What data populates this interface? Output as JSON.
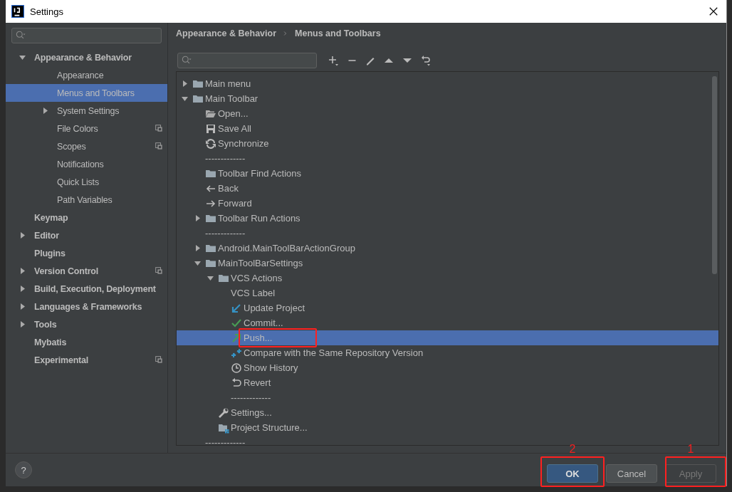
{
  "window": {
    "title": "Settings"
  },
  "sidebar": {
    "items": [
      {
        "label": "Appearance & Behavior",
        "expanded": true,
        "selected": false,
        "project_level": false,
        "children": [
          {
            "label": "Appearance",
            "selected": false,
            "project_level": false
          },
          {
            "label": "Menus and Toolbars",
            "selected": true,
            "project_level": false
          },
          {
            "label": "System Settings",
            "expanded": false,
            "selected": false,
            "project_level": false
          },
          {
            "label": "File Colors",
            "selected": false,
            "project_level": true
          },
          {
            "label": "Scopes",
            "selected": false,
            "project_level": true
          },
          {
            "label": "Notifications",
            "selected": false,
            "project_level": false
          },
          {
            "label": "Quick Lists",
            "selected": false,
            "project_level": false
          },
          {
            "label": "Path Variables",
            "selected": false,
            "project_level": false
          }
        ]
      },
      {
        "label": "Keymap",
        "selected": false,
        "project_level": false
      },
      {
        "label": "Editor",
        "expanded": false,
        "selected": false,
        "project_level": false
      },
      {
        "label": "Plugins",
        "selected": false,
        "project_level": false
      },
      {
        "label": "Version Control",
        "expanded": false,
        "selected": false,
        "project_level": true
      },
      {
        "label": "Build, Execution, Deployment",
        "expanded": false,
        "selected": false,
        "project_level": false
      },
      {
        "label": "Languages & Frameworks",
        "expanded": false,
        "selected": false,
        "project_level": false
      },
      {
        "label": "Tools",
        "expanded": false,
        "selected": false,
        "project_level": false
      },
      {
        "label": "Mybatis",
        "selected": false,
        "project_level": false
      },
      {
        "label": "Experimental",
        "selected": false,
        "project_level": true
      }
    ]
  },
  "breadcrumb": [
    "Appearance & Behavior",
    "Menus and Toolbars"
  ],
  "toolbar": [
    {
      "kind": "add"
    },
    {
      "kind": "remove"
    },
    {
      "kind": "edit"
    },
    {
      "kind": "up"
    },
    {
      "kind": "down"
    },
    {
      "kind": "restore"
    }
  ],
  "tree": [
    {
      "label": "Main menu",
      "kind": "folder",
      "expanded": false,
      "selected": false
    },
    {
      "label": "Main Toolbar",
      "kind": "folder",
      "expanded": true,
      "selected": false,
      "children": [
        {
          "label": "Open...",
          "kind": "open",
          "selected": false
        },
        {
          "label": "Save All",
          "kind": "save",
          "selected": false
        },
        {
          "label": "Synchronize",
          "kind": "sync",
          "selected": false
        },
        {
          "label": "-------------",
          "kind": "separator",
          "selected": false
        },
        {
          "label": "Toolbar Find Actions",
          "kind": "folder",
          "selected": false
        },
        {
          "label": "Back",
          "kind": "back",
          "selected": false
        },
        {
          "label": "Forward",
          "kind": "forward",
          "selected": false
        },
        {
          "label": "Toolbar Run Actions",
          "kind": "folder",
          "expanded": false,
          "selected": false
        },
        {
          "label": "-------------",
          "kind": "separator",
          "selected": false
        },
        {
          "label": "Android.MainToolBarActionGroup",
          "kind": "folder",
          "expanded": false,
          "selected": false
        },
        {
          "label": "MainToolBarSettings",
          "kind": "folder",
          "expanded": true,
          "selected": false,
          "children": [
            {
              "label": "VCS Actions",
              "kind": "folder",
              "expanded": true,
              "selected": false,
              "children": [
                {
                  "label": "VCS Label",
                  "kind": "label",
                  "selected": false
                },
                {
                  "label": "Update Project",
                  "kind": "update",
                  "selected": false
                },
                {
                  "label": "Commit...",
                  "kind": "commit",
                  "selected": false
                },
                {
                  "label": "Push...",
                  "kind": "push",
                  "selected": true,
                  "annotated": true
                },
                {
                  "label": "Compare with the Same Repository Version",
                  "kind": "compare",
                  "selected": false
                },
                {
                  "label": "Show History",
                  "kind": "history",
                  "selected": false
                },
                {
                  "label": "Revert",
                  "kind": "revert",
                  "selected": false
                },
                {
                  "label": "-------------",
                  "kind": "separator",
                  "selected": false
                }
              ]
            },
            {
              "label": "Settings...",
              "kind": "settings",
              "selected": false
            },
            {
              "label": "Project Structure...",
              "kind": "structure",
              "selected": false
            }
          ]
        },
        {
          "label": "-------------",
          "kind": "separator",
          "selected": false
        }
      ]
    }
  ],
  "footer": {
    "help": "?",
    "buttons": [
      {
        "label": "OK",
        "kind": "primary",
        "annotation": "2"
      },
      {
        "label": "Cancel",
        "kind": "normal"
      },
      {
        "label": "Apply",
        "kind": "disabled",
        "annotation": "1"
      }
    ]
  }
}
